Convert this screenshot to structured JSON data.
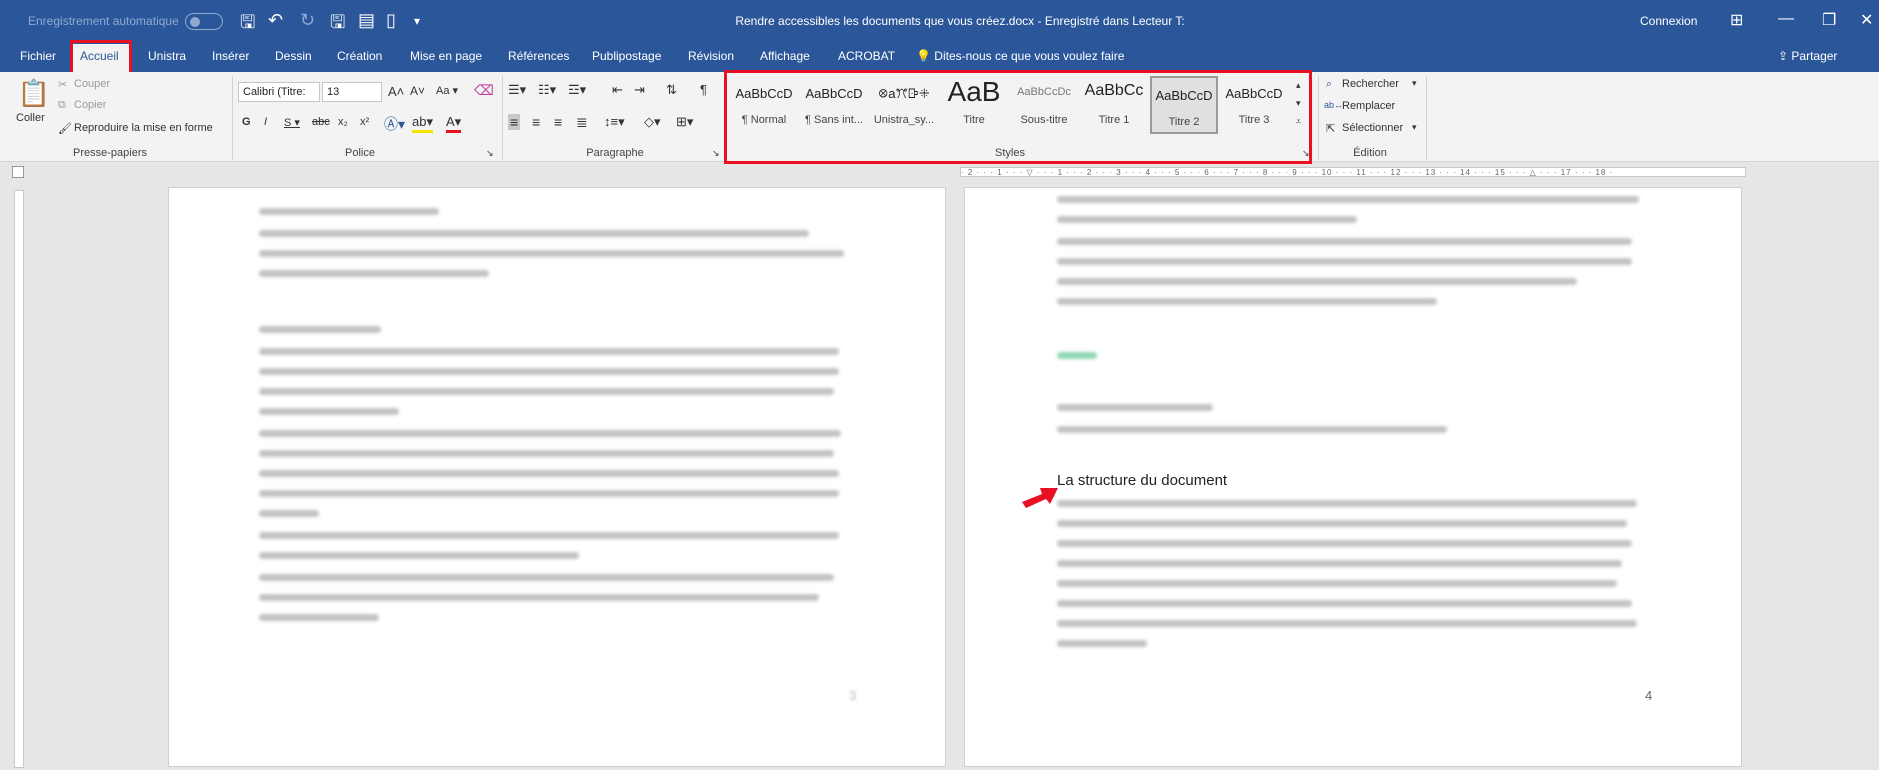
{
  "titlebar": {
    "autosave": "Enregistrement automatique",
    "document_title": "Rendre accessibles les documents que vous créez.docx - Enregistré dans Lecteur T:",
    "connexion": "Connexion"
  },
  "tabs": [
    "Fichier",
    "Accueil",
    "Unistra",
    "Insérer",
    "Dessin",
    "Création",
    "Mise en page",
    "Références",
    "Publipostage",
    "Révision",
    "Affichage",
    "ACROBAT"
  ],
  "active_tab": "Accueil",
  "tell_me": "Dites-nous ce que vous voulez faire",
  "share": "Partager",
  "clipboard": {
    "paste": "Coller",
    "cut": "Couper",
    "copy": "Copier",
    "format_painter": "Reproduire la mise en forme",
    "label": "Presse-papiers"
  },
  "font": {
    "name": "Calibri (Titre:",
    "size": "13",
    "label": "Police"
  },
  "paragraph": {
    "label": "Paragraphe"
  },
  "styles": {
    "label": "Styles",
    "items": [
      {
        "preview": "AaBbCcD",
        "name": "¶ Normal"
      },
      {
        "preview": "AaBbCcD",
        "name": "¶ Sans int..."
      },
      {
        "preview": "ꕕaꔫꕒꔰ",
        "name": "Unistra_sy..."
      },
      {
        "preview": "AaB",
        "name": "Titre"
      },
      {
        "preview": "AaBbCcDc",
        "name": "Sous-titre"
      },
      {
        "preview": "AaBbCc",
        "name": "Titre 1"
      },
      {
        "preview": "AaBbCcD",
        "name": "Titre 2"
      },
      {
        "preview": "AaBbCcD",
        "name": "Titre 3"
      }
    ]
  },
  "editing": {
    "find": "Rechercher",
    "replace": "Remplacer",
    "select": "Sélectionner",
    "label": "Édition"
  },
  "document": {
    "heading": "La structure du document",
    "page_left_number": "3",
    "page_right_number": "4"
  }
}
